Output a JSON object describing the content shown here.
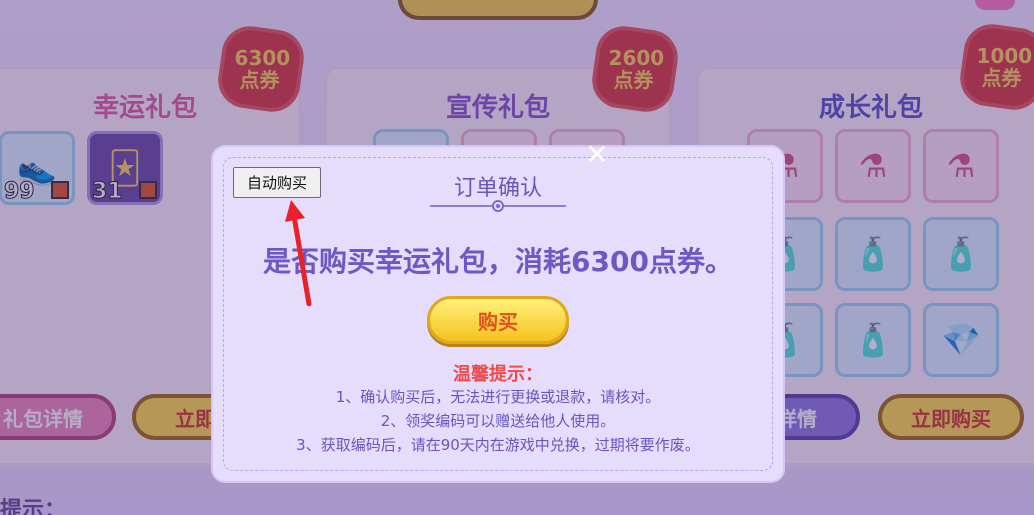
{
  "shop": {
    "cards": [
      {
        "title": "幸运礼包",
        "price_amount": "6300",
        "price_unit": "点券",
        "items": [
          {
            "icon": "shoe-icon",
            "count": "99"
          },
          {
            "icon": "card-icon",
            "count": "31"
          }
        ],
        "detail_label": "礼包详情",
        "buy_label": "立即购"
      },
      {
        "title": "宣传礼包",
        "price_amount": "2600",
        "price_unit": "点券"
      },
      {
        "title": "成长礼包",
        "price_amount": "1000",
        "price_unit": "点券",
        "detail_label": "包详情",
        "buy_label": "立即购买"
      }
    ],
    "bottom_hint": "提示："
  },
  "dialog": {
    "auto_buy_label": "自动购买",
    "title": "订单确认",
    "question": "是否购买幸运礼包，消耗6300点券。",
    "buy_label": "购买",
    "tips_title": "温馨提示：",
    "tips": [
      "1、确认购买后，无法进行更换或退款，请核对。",
      "2、领奖编码可以赠送给他人使用。",
      "3、获取编码后，请在90天内在游戏中兑换，过期将要作废。"
    ],
    "close_symbol": "✕"
  },
  "colors": {
    "accent": "#6c59c2",
    "warning": "#ef4b4b",
    "button_gold": "#f6c21e",
    "annotation_arrow": "#e8212a"
  }
}
